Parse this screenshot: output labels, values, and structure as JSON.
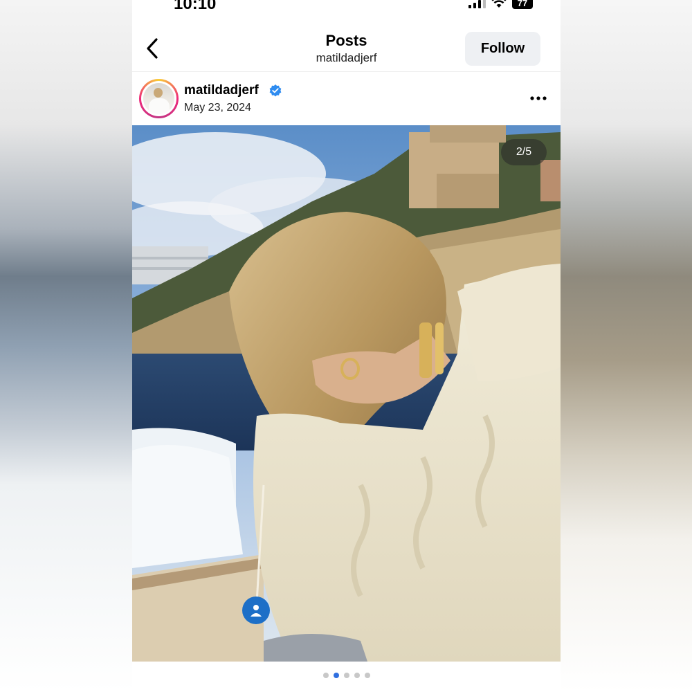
{
  "status_bar": {
    "time": "10:10",
    "battery": "77"
  },
  "header": {
    "title": "Posts",
    "subtitle": "matildadjerf",
    "follow_label": "Follow"
  },
  "post": {
    "username": "matildadjerf",
    "date": "May 23, 2024",
    "verified": true,
    "counter": "2/5",
    "current_slide": 2,
    "total_slides": 5
  },
  "icons": {
    "back": "chevron-left-icon",
    "more": "ellipsis-icon",
    "verified": "verified-badge-icon",
    "tag": "person-tag-icon"
  },
  "colors": {
    "accent": "#2f6fe0",
    "verified": "#2f8cf0",
    "tag": "#1d6fc7"
  }
}
